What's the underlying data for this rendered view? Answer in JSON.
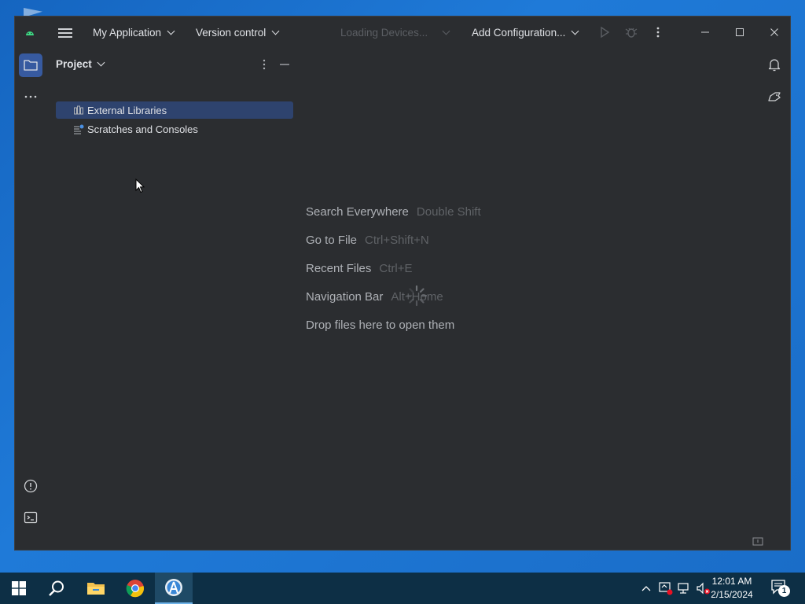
{
  "window": {
    "project_menu": "My Application",
    "vcs_menu": "Version control",
    "devices": "Loading Devices...",
    "run_config": "Add Configuration..."
  },
  "project_panel": {
    "title": "Project",
    "items": [
      {
        "label": "External Libraries",
        "icon": "library-icon",
        "selected": true
      },
      {
        "label": "Scratches and Consoles",
        "icon": "scratches-icon",
        "selected": false
      }
    ]
  },
  "editor": {
    "hints": [
      {
        "label": "Search Everywhere",
        "shortcut": "Double Shift"
      },
      {
        "label": "Go to File",
        "shortcut": "Ctrl+Shift+N"
      },
      {
        "label": "Recent Files",
        "shortcut": "Ctrl+E"
      },
      {
        "label": "Navigation Bar",
        "shortcut": "Alt+Home"
      },
      {
        "label": "Drop files here to open them",
        "shortcut": ""
      }
    ]
  },
  "taskbar": {
    "time": "12:01 AM",
    "date": "2/15/2024",
    "notification_count": "1"
  },
  "colors": {
    "ide_bg": "#2b2d30",
    "selection": "#2e436e",
    "accent": "#375aa0",
    "taskbar_bg": "#0d2f45"
  }
}
